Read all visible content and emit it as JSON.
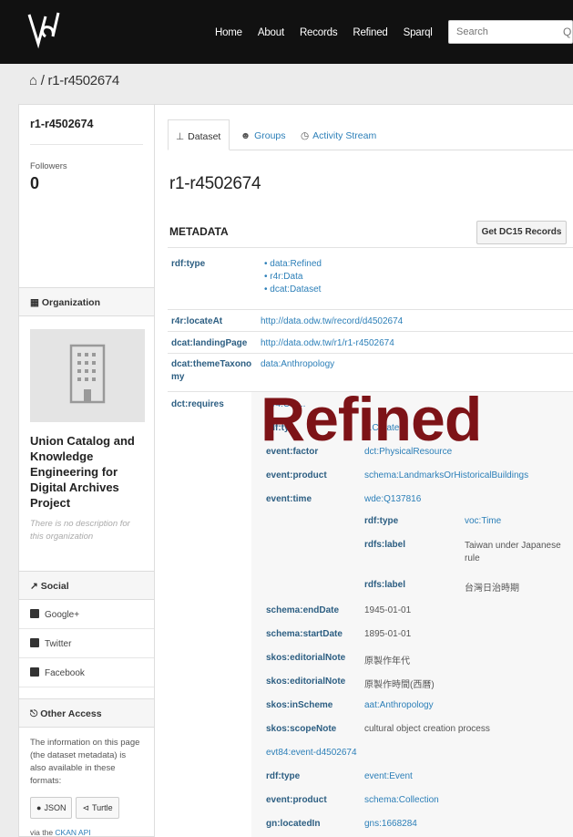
{
  "nav": {
    "items": [
      "Home",
      "About",
      "Records",
      "Refined",
      "Sparql"
    ],
    "search_placeholder": "Search"
  },
  "breadcrumb": {
    "home_icon": "home-icon",
    "separator": "/",
    "current": "r1-r4502674"
  },
  "sidebar": {
    "title": "r1-r4502674",
    "followers_label": "Followers",
    "followers_count": "0",
    "organization_heading": "Organization",
    "org_name": "Union Catalog and Knowledge Engineering for Digital Archives Project",
    "org_description": "There is no description for this organization",
    "social_heading": "Social",
    "social_items": [
      "Google+",
      "Twitter",
      "Facebook"
    ],
    "other_access_heading": "Other Access",
    "other_access_text": "The information on this page (the dataset metadata) is also available in these formats:",
    "json_label": "JSON",
    "turtle_label": "Turtle",
    "via_prefix": "via the",
    "via_link": "CKAN API"
  },
  "tabs": [
    "Dataset",
    "Groups",
    "Activity Stream"
  ],
  "page_title": "r1-r4502674",
  "metadata_heading": "METADATA",
  "dc_button": "Get DC15 Records",
  "watermark": "Refined",
  "metadata": {
    "rdf_type_key": "rdf:type",
    "rdf_type_values": [
      "data:Refined",
      "r4r:Data",
      "dcat:Dataset"
    ],
    "locate_key": "r4r:locateAt",
    "locate_val": "http://data.odw.tw/record/d4502674",
    "landing_key": "dcat:landingPage",
    "landing_val": "http://data.odw.tw/r1/r1-r4502674",
    "theme_key_1": "dcat:themeTaxono",
    "theme_key_2": "my",
    "theme_val": "data:Anthropology",
    "requires_key": "dct:requires",
    "partial_top": "ev4:Cre...",
    "partial_key": "rdf:ty...",
    "partial_val": "...Create...",
    "nested": [
      {
        "k": "event:factor",
        "v": "dct:PhysicalResource"
      },
      {
        "k": "event:product",
        "v": "schema:LandmarksOrHistoricalBuildings"
      },
      {
        "k": "event:time",
        "v": "wde:Q137816"
      },
      {
        "k": "schema:endDate",
        "v": "1945-01-01"
      },
      {
        "k": "schema:startDate",
        "v": "1895-01-01"
      },
      {
        "k": "skos:editorialNote",
        "v": "原製作年代"
      },
      {
        "k": "skos:editorialNote",
        "v": "原製作時間(西曆)"
      },
      {
        "k": "skos:inScheme",
        "v": "aat:Anthropology"
      },
      {
        "k": "skos:scopeNote",
        "v": "cultural object creation process"
      }
    ],
    "time_nested": [
      {
        "k": "rdf:type",
        "v": "voc:Time"
      },
      {
        "k": "rdfs:label",
        "v": "Taiwan under Japanese rule"
      },
      {
        "k": "rdfs:label",
        "v": "台灣日治時期"
      }
    ],
    "event_id": "evt84:event-d4502674",
    "event_rows": [
      {
        "k": "rdf:type",
        "v": "event:Event"
      },
      {
        "k": "event:product",
        "v": "schema:Collection"
      },
      {
        "k": "gn:locatedIn",
        "v": "gns:1668284"
      }
    ]
  }
}
